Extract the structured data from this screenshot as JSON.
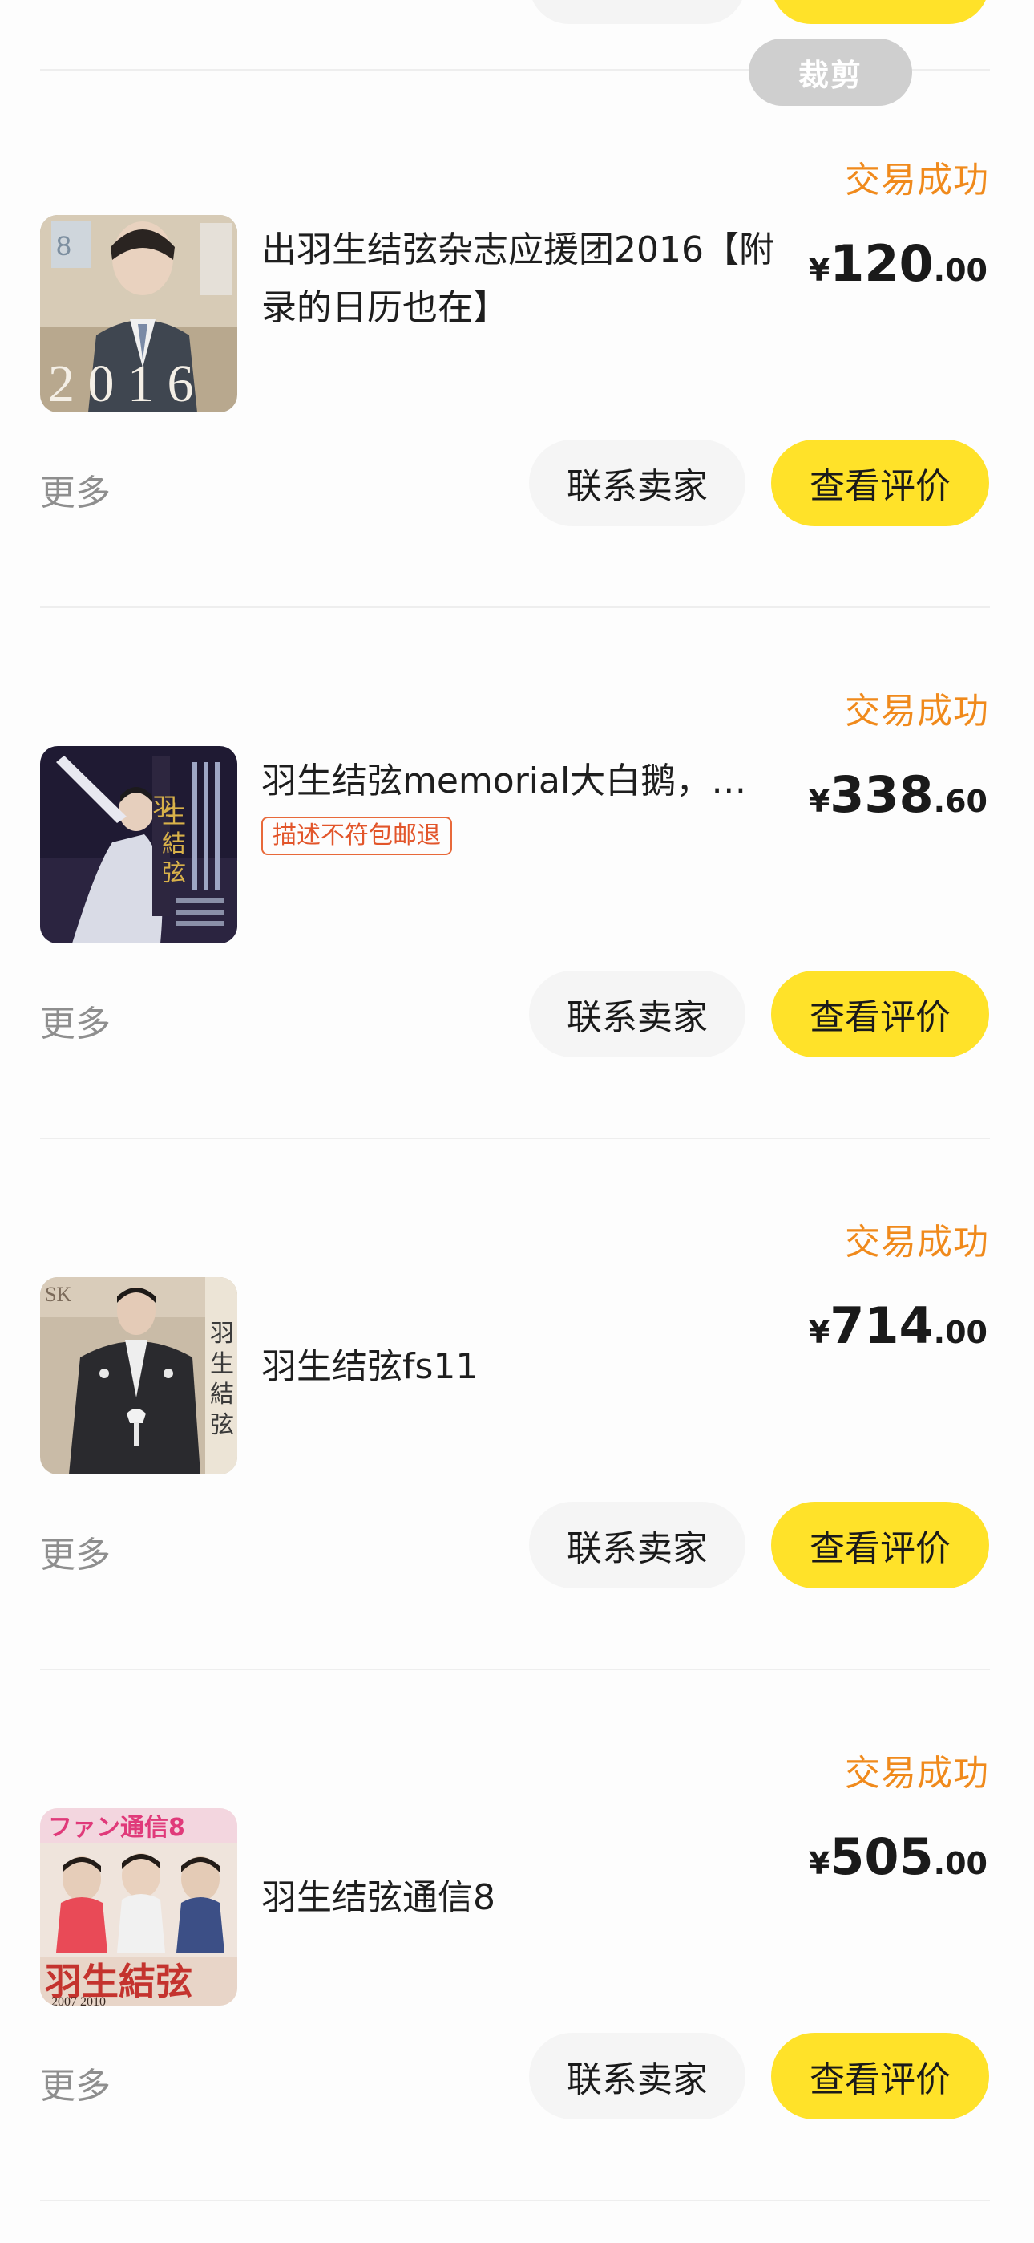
{
  "crop_label": "裁剪",
  "orders": [
    {
      "status": "交易成功",
      "title": "出羽生结弦杂志应援团2016【附录的日历也在】",
      "tag": "",
      "price_symbol": "¥",
      "price_int": "120",
      "price_dec": ".00",
      "more": "更多",
      "contact": "联系卖家",
      "review": "查看评价"
    },
    {
      "status": "交易成功",
      "title": "羽生结弦memorial大白鹅，…",
      "tag": "描述不符包邮退",
      "price_symbol": "¥",
      "price_int": "338",
      "price_dec": ".60",
      "more": "更多",
      "contact": "联系卖家",
      "review": "查看评价"
    },
    {
      "status": "交易成功",
      "title": "羽生结弦fs11",
      "tag": "",
      "price_symbol": "¥",
      "price_int": "714",
      "price_dec": ".00",
      "more": "更多",
      "contact": "联系卖家",
      "review": "查看评价"
    },
    {
      "status": "交易成功",
      "title": "羽生结弦通信8",
      "tag": "",
      "price_symbol": "¥",
      "price_int": "505",
      "price_dec": ".00",
      "more": "更多",
      "contact": "联系卖家",
      "review": "查看评价"
    }
  ],
  "thumb_text": {
    "year": "2 0 1 6",
    "fan_magazine": "ファン通信8",
    "fan_name": "羽生結弦",
    "fan_years": "2007 2010",
    "kanji_vertical": "羽生結弦"
  },
  "colors": {
    "accent_yellow": "#ffe229",
    "status_orange": "#f08a1c",
    "tag_red": "#e2552a"
  }
}
